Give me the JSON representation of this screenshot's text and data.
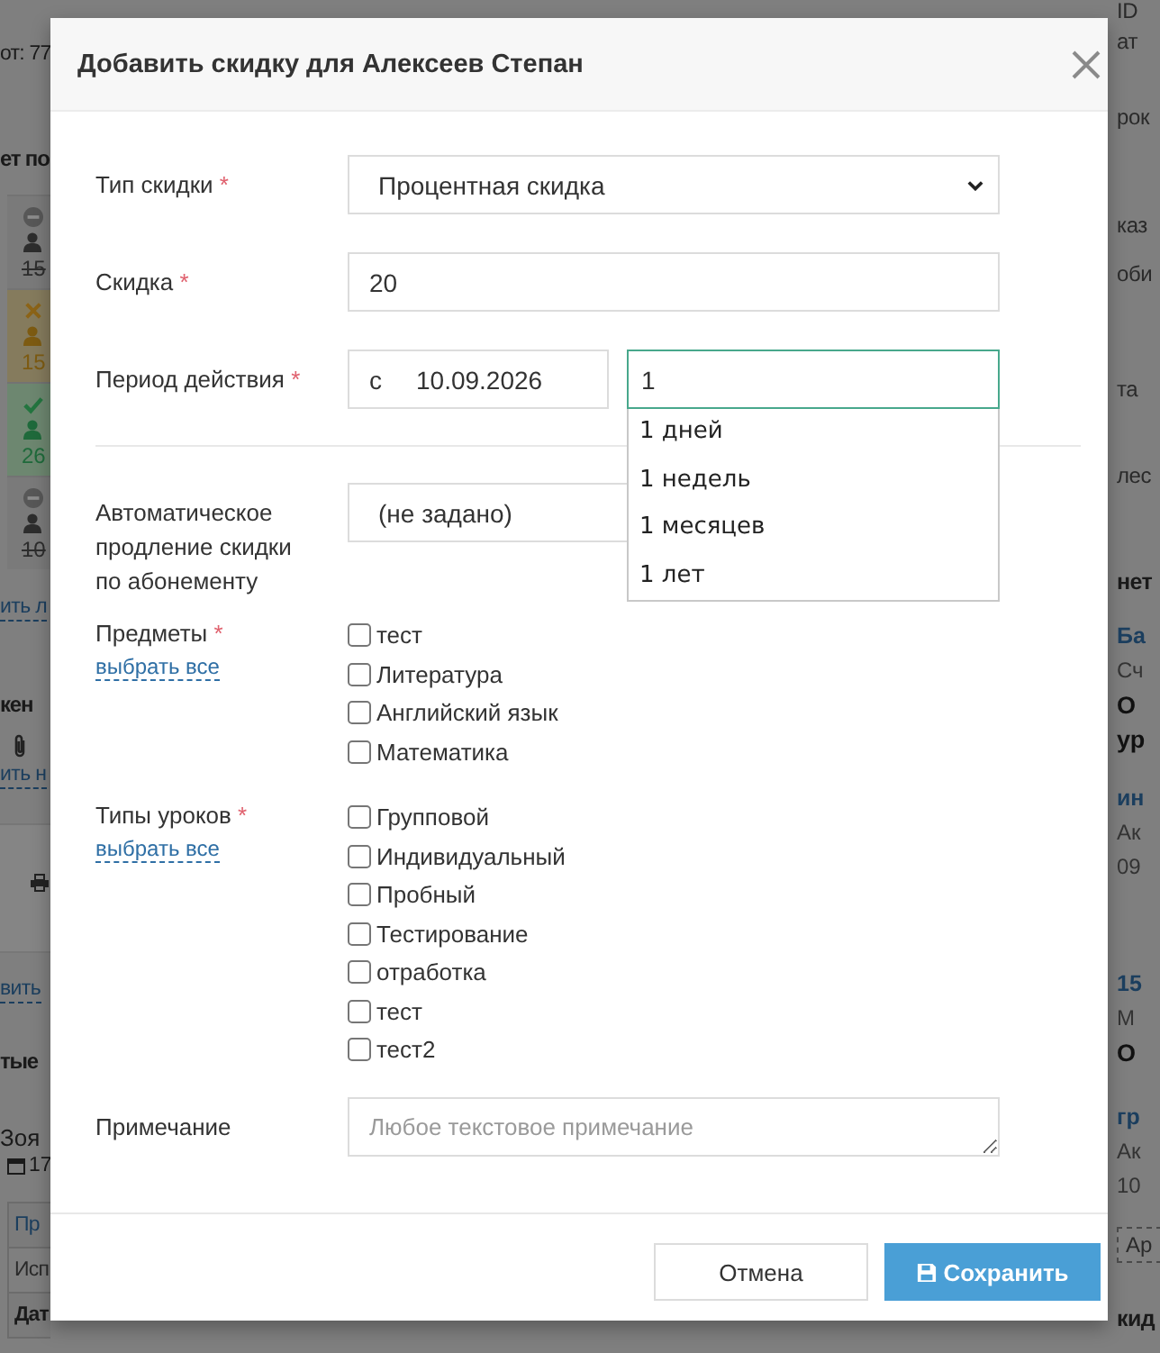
{
  "background": {
    "left": {
      "summary": "от: 77",
      "attendance_heading": "ет по",
      "attendance_cards": [
        {
          "kind": "cancelled",
          "count": "15"
        },
        {
          "kind": "missed",
          "count": "15"
        },
        {
          "kind": "attended",
          "count": "26"
        },
        {
          "kind": "cancelled",
          "count": "10"
        }
      ],
      "attendance_link": "ить л",
      "files_heading": "кен",
      "files_link": "ить н",
      "add_link": "вить",
      "events_heading": "тые",
      "event": {
        "name": "Зоя",
        "date": "17"
      },
      "table_rows": [
        {
          "kind": "link",
          "text": "Пр"
        },
        {
          "kind": "text",
          "text": "Исп"
        },
        {
          "kind": "strong",
          "text": "Дат"
        }
      ]
    },
    "right": {
      "detail_labels": [
        "ID",
        "ат",
        "рок",
        "каз",
        "оби",
        "та",
        "лес"
      ],
      "heading": "нет",
      "entries": [
        {
          "link": "Ба",
          "lines": [
            {
              "kind": "muted",
              "text": "Сч"
            },
            {
              "kind": "strong",
              "text": "О"
            },
            {
              "kind": "strong",
              "text": "ур"
            }
          ]
        },
        {
          "link": "ин",
          "lines": [
            {
              "kind": "muted",
              "text": "Ак"
            },
            {
              "kind": "muted",
              "text": "09"
            }
          ]
        },
        {
          "link": "15",
          "lines": [
            {
              "kind": "muted",
              "text": "М"
            },
            {
              "kind": "strong",
              "text": "О"
            }
          ]
        },
        {
          "link": "гр",
          "lines": [
            {
              "kind": "muted",
              "text": "Ак"
            },
            {
              "kind": "muted",
              "text": "10"
            }
          ]
        }
      ],
      "button": "Ар",
      "footer_heading": "кид"
    }
  },
  "dialog": {
    "title": "Добавить скидку для Алексеев Степан",
    "sections": [
      {
        "fields": [
          {
            "kind": "select",
            "label": "Тип скидки",
            "required_mark": "*",
            "value": "Процентная скидка"
          },
          {
            "kind": "input",
            "label": "Скидка",
            "required_mark": "*",
            "value": "20"
          },
          {
            "kind": "period",
            "label": "Период действия",
            "required_mark": "*",
            "date_prefix": "с",
            "date": "10.09.2026",
            "duration": {
              "value": "1",
              "focused": true,
              "suggestions": [
                "1 дней",
                "1 недель",
                "1 месяцев",
                "1 лет"
              ]
            }
          }
        ]
      },
      {
        "fields": [
          {
            "kind": "select",
            "label": "Автоматическое продление скидки по абонементу",
            "value": "(не задано)"
          },
          {
            "kind": "checklist",
            "label": "Предметы",
            "required_mark": "*",
            "select_all": "выбрать все",
            "options": [
              {
                "label": "тест",
                "checked": false
              },
              {
                "label": "Литература",
                "checked": false
              },
              {
                "label": "Английский язык",
                "checked": false
              },
              {
                "label": "Математика",
                "checked": false
              }
            ]
          },
          {
            "kind": "checklist",
            "label": "Типы уроков",
            "required_mark": "*",
            "select_all": "выбрать все",
            "options": [
              {
                "label": "Групповой",
                "checked": false
              },
              {
                "label": "Индивидуальный",
                "checked": false
              },
              {
                "label": "Пробный",
                "checked": false
              },
              {
                "label": "Тестирование",
                "checked": false
              },
              {
                "label": "отработка",
                "checked": false
              },
              {
                "label": "тест",
                "checked": false
              },
              {
                "label": "тест2",
                "checked": false
              }
            ]
          },
          {
            "kind": "textarea",
            "label": "Примечание",
            "placeholder": "Любое текстовое примечание"
          }
        ]
      }
    ],
    "buttons": [
      {
        "kind": "secondary",
        "label": "Отмена"
      },
      {
        "kind": "primary",
        "label": "Сохранить"
      }
    ]
  }
}
